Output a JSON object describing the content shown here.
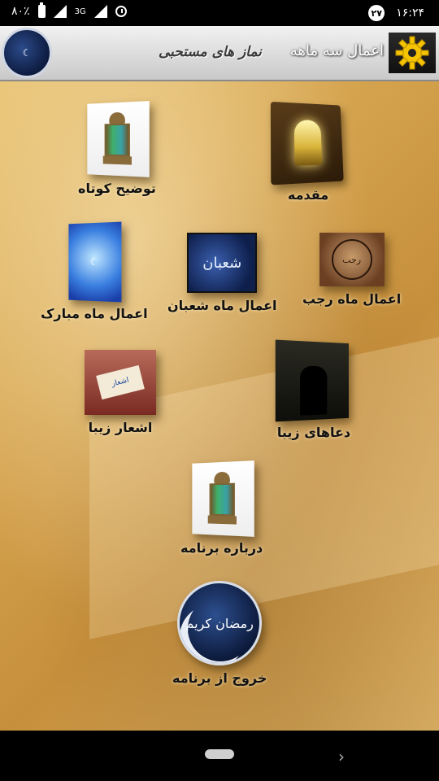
{
  "status_bar": {
    "battery": "۸۰٪",
    "network": "3G",
    "date_badge": "۲۷",
    "time": "۱۶:۲۴"
  },
  "app_bar": {
    "title": "اعمال سه ماهه",
    "subtitle": "نماز های مستحبی",
    "settings_icon": "gear-icon"
  },
  "menu": {
    "short_description": "توضیح کوتاه",
    "introduction": "مقدمه",
    "month_mobarak": "اعمال ماه مبارک",
    "month_shaban": "اعمال ماه شعبان",
    "month_rajab": "اعمال ماه رجب",
    "beautiful_poems": "اشعار زیبا",
    "beautiful_prayers": "دعاهای زیبا",
    "about_app": "درباره برنامه",
    "exit_app": "خروج از برنامه"
  },
  "images": {
    "shaban_text": "شعبان",
    "poem_text": "اشعار",
    "exit_calligraphy": "رمضان کریم"
  }
}
